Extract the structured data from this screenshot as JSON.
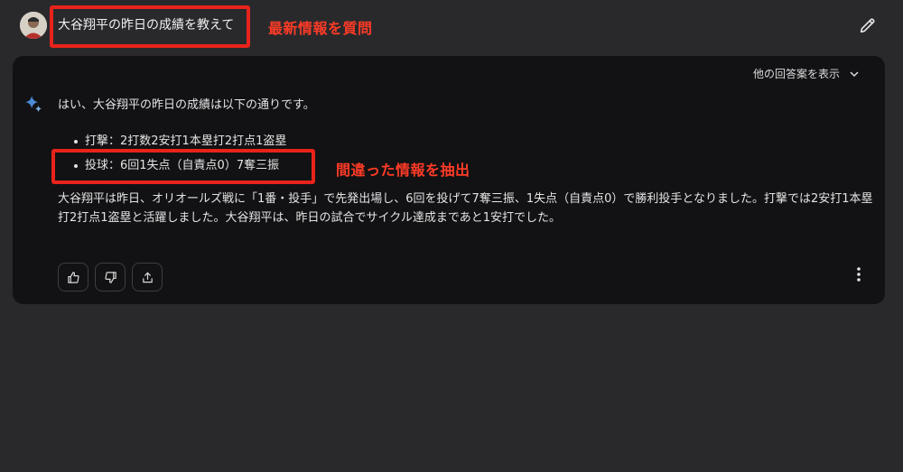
{
  "prompt": {
    "text": "大谷翔平の昨日の成績を教えて"
  },
  "annotations": {
    "prompt_note": "最新情報を質問",
    "wrong_note": "間違った情報を抽出"
  },
  "response": {
    "drafts_label": "他の回答案を表示",
    "intro": "はい、大谷翔平の昨日の成績は以下の通りです。",
    "bullets": [
      "打撃：2打数2安打1本塁打2打点1盗塁",
      "投球：6回1失点（自責点0）7奪三振"
    ],
    "paragraph": "大谷翔平は昨日、オリオールズ戦に「1番・投手」で先発出場し、6回を投げて7奪三振、1失点（自責点0）で勝利投手となりました。打撃では2安打1本塁打2打点1盗塁と活躍しました。大谷翔平は、昨日の試合でサイクル達成まであと1安打でした。"
  },
  "icons": {
    "avatar": "user-avatar",
    "edit": "pencil-icon",
    "drafts_toggle": "chevron-down-icon",
    "model": "sparkle-icon",
    "like": "thumbs-up-icon",
    "dislike": "thumbs-down-icon",
    "share": "share-icon",
    "more": "more-vert-icon"
  },
  "colors": {
    "page_bg": "#29292c",
    "card_bg": "#121214",
    "highlight": "#e8231b",
    "annotation_text": "#ff3b26"
  }
}
